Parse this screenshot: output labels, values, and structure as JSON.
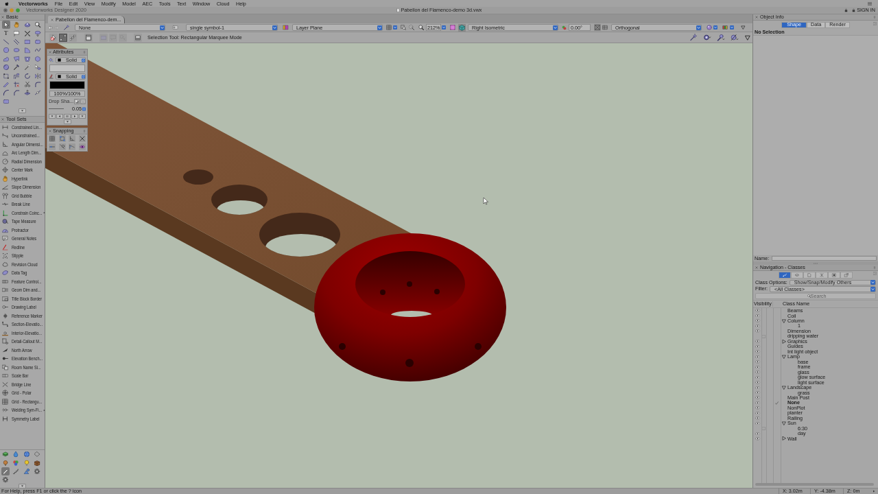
{
  "menu_bar": {
    "app_name": "Vectorworks",
    "items": [
      "File",
      "Edit",
      "View",
      "Modify",
      "Model",
      "AEC",
      "Tools",
      "Text",
      "Window",
      "Cloud",
      "Help"
    ]
  },
  "window": {
    "app_title": "Vectorworks Designer 2020",
    "document_title": "Pabellon del Flamenco-demo 3d.vwx",
    "sign_in": "SIGN IN"
  },
  "document_tabs": [
    {
      "label": "Pabellon del Flamenco-dem...",
      "selected": true
    }
  ],
  "view_bar": {
    "history_buttons": [
      {
        "disabled": false
      },
      {
        "disabled": true
      }
    ],
    "class": "None",
    "symbol": "single symbol-1",
    "plane": "Layer Plane",
    "zoom": "212%",
    "view": "Right Isometric",
    "rotation": "0.00°",
    "projection": "Orthogonal"
  },
  "mode_bar": {
    "modes": [
      {
        "selected": false,
        "disabled": false
      },
      {
        "selected": true,
        "disabled": false
      },
      {
        "selected": false,
        "disabled": false
      },
      {
        "selected": false,
        "disabled": false
      },
      {
        "selected": false,
        "disabled": true
      },
      {
        "selected": false,
        "disabled": true
      },
      {
        "selected": false,
        "disabled": true
      },
      {
        "selected": false,
        "disabled": false
      }
    ],
    "hint": "Selection Tool: Rectangular Marquee Mode"
  },
  "basic_palette": {
    "title": "Basic",
    "tools": [
      {
        "selected": true
      },
      {
        "selected": false
      },
      {
        "selected": false
      },
      {
        "selected": false
      },
      {
        "selected": false,
        "glyph": "T"
      },
      {
        "selected": false
      },
      {
        "selected": false
      },
      {
        "selected": false
      },
      {
        "selected": false
      },
      {
        "selected": false
      },
      {
        "selected": false
      },
      {
        "selected": false
      },
      {
        "selected": false
      },
      {
        "selected": false
      },
      {
        "selected": false
      },
      {
        "selected": false
      },
      {
        "selected": false
      },
      {
        "selected": false
      },
      {
        "selected": false
      },
      {
        "selected": false
      },
      {
        "selected": false
      },
      {
        "selected": false
      },
      {
        "selected": false
      },
      {
        "selected": false
      },
      {
        "selected": false
      },
      {
        "selected": false
      },
      {
        "selected": false
      },
      {
        "selected": false
      },
      {
        "selected": false
      },
      {
        "selected": false
      },
      {
        "selected": false
      },
      {
        "selected": false
      },
      {
        "selected": false
      },
      {
        "selected": false
      },
      {
        "selected": false
      },
      {
        "selected": false
      },
      {
        "selected": false
      }
    ]
  },
  "tool_sets_palette": {
    "title": "Tool Sets",
    "tools": [
      {
        "label": "Constrained Lin...",
        "submenu": false
      },
      {
        "label": "Unconstrained...",
        "submenu": false
      },
      {
        "label": "Angular Dimensi...",
        "submenu": false
      },
      {
        "label": "Arc Length Dim...",
        "submenu": false
      },
      {
        "label": "Radial Dimension",
        "submenu": false
      },
      {
        "label": "Center Mark",
        "submenu": false
      },
      {
        "label": "Hyperlink",
        "submenu": false
      },
      {
        "label": "Slope Dimension",
        "submenu": false
      },
      {
        "label": "Grid Bubble",
        "submenu": false
      },
      {
        "label": "Break Line",
        "submenu": false
      },
      {
        "label": "Constrain Coinc...",
        "submenu": true
      },
      {
        "label": "Tape Measure",
        "submenu": false
      },
      {
        "label": "Protractor",
        "submenu": false
      },
      {
        "label": "General Notes",
        "submenu": false
      },
      {
        "label": "Redline",
        "submenu": false
      },
      {
        "label": "Stipple",
        "submenu": false
      },
      {
        "label": "Revision Cloud",
        "submenu": false
      },
      {
        "label": "Data Tag",
        "submenu": false
      },
      {
        "label": "Feature Control...",
        "submenu": false
      },
      {
        "label": "Geom Dim and...",
        "submenu": false
      },
      {
        "label": "Title Block Border",
        "submenu": false
      },
      {
        "label": "Drawing Label",
        "submenu": false
      },
      {
        "label": "Reference Marker",
        "submenu": false
      },
      {
        "label": "Section-Elevatio...",
        "submenu": false
      },
      {
        "label": "Interior-Elevatio...",
        "submenu": false
      },
      {
        "label": "Detail-Callout M...",
        "submenu": false
      },
      {
        "label": "North Arrow",
        "submenu": false
      },
      {
        "label": "Elevation Bench...",
        "submenu": false
      },
      {
        "label": "Room Name Si...",
        "submenu": false
      },
      {
        "label": "Scale Bar",
        "submenu": false
      },
      {
        "label": "Bridge Line",
        "submenu": false
      },
      {
        "label": "Grid - Polar",
        "submenu": false
      },
      {
        "label": "Grid - Rectangu...",
        "submenu": false
      },
      {
        "label": "Welding Sym-Fi...",
        "submenu": true
      },
      {
        "label": "Symmetry Label",
        "submenu": false
      }
    ]
  },
  "tool_set_buttons": [
    {
      "selected": false
    },
    {
      "selected": false
    },
    {
      "selected": false
    },
    {
      "selected": false
    },
    {
      "selected": false
    },
    {
      "selected": false
    },
    {
      "selected": false
    },
    {
      "selected": false
    },
    {
      "selected": true
    },
    {
      "selected": false
    },
    {
      "selected": false
    },
    {
      "selected": false
    },
    {
      "selected": false
    }
  ],
  "attributes_palette": {
    "title": "Attributes",
    "fill_style": "Solid",
    "pen_style": "Solid",
    "opacity": "100%/100%",
    "drop_shadow": "Drop Sha...",
    "line_weight": "0.05"
  },
  "snapping_palette": {
    "title": "Snapping"
  },
  "object_info": {
    "title": "Object Info",
    "tabs": [
      {
        "label": "Shape",
        "selected": true
      },
      {
        "label": "Data",
        "selected": false
      },
      {
        "label": "Render",
        "selected": false
      }
    ],
    "selection": "No Selection",
    "name_label": "Name:"
  },
  "navigation": {
    "title": "Navigation - Classes",
    "views": [
      {
        "selected": true
      },
      {
        "selected": false
      },
      {
        "selected": false
      },
      {
        "selected": false
      },
      {
        "selected": false
      },
      {
        "selected": false
      }
    ],
    "class_options_label": "Class Options:",
    "class_options": "Show/Snap/Modify Others",
    "filter_label": "Filter:",
    "filter": "<All Classes>",
    "search_placeholder": "Search",
    "columns": [
      "Visibility",
      "Class Name"
    ],
    "classes": [
      {
        "name": "Beams",
        "grayed": false,
        "active": false
      },
      {
        "name": "Coil",
        "grayed": false,
        "active": false
      },
      {
        "name": "Column",
        "grayed": false,
        "active": false,
        "expanded": true,
        "children": [
          {
            "name": "1",
            "grayed": false,
            "active": false
          }
        ]
      },
      {
        "name": "Dimension",
        "grayed": false,
        "active": false
      },
      {
        "name": "dripping water",
        "grayed": true,
        "active": false
      },
      {
        "name": "Graphics",
        "grayed": false,
        "active": false,
        "expanded": false
      },
      {
        "name": "Guides",
        "grayed": false,
        "active": false
      },
      {
        "name": "Int light object",
        "grayed": false,
        "active": false
      },
      {
        "name": "Lamp",
        "grayed": false,
        "active": false,
        "expanded": true,
        "children": [
          {
            "name": "base",
            "grayed": false,
            "active": false
          },
          {
            "name": "frame",
            "grayed": false,
            "active": false
          },
          {
            "name": "glass",
            "grayed": false,
            "active": false
          },
          {
            "name": "glow surface",
            "grayed": false,
            "active": false
          },
          {
            "name": "light surface",
            "grayed": false,
            "active": false
          }
        ]
      },
      {
        "name": "Landscape",
        "grayed": false,
        "active": false,
        "expanded": true,
        "children": [
          {
            "name": "grass",
            "grayed": false,
            "active": false
          }
        ]
      },
      {
        "name": "Main Post",
        "grayed": false,
        "active": false
      },
      {
        "name": "None",
        "grayed": false,
        "active": true
      },
      {
        "name": "NonPlot",
        "grayed": false,
        "active": false
      },
      {
        "name": "planter",
        "grayed": false,
        "active": false
      },
      {
        "name": "Railing",
        "grayed": false,
        "active": false
      },
      {
        "name": "Sun",
        "grayed": false,
        "active": false,
        "expanded": true,
        "children": [
          {
            "name": "6:30",
            "grayed": true,
            "active": false
          },
          {
            "name": "day",
            "grayed": false,
            "active": false
          }
        ]
      },
      {
        "name": "Wall",
        "grayed": false,
        "active": false,
        "expanded": false
      }
    ]
  },
  "status_bar": {
    "help": "For Help, press F1 or click the ? icon",
    "x": "X: 3.02m",
    "y": "Y: -4.38m",
    "z": "Z: 0m"
  }
}
